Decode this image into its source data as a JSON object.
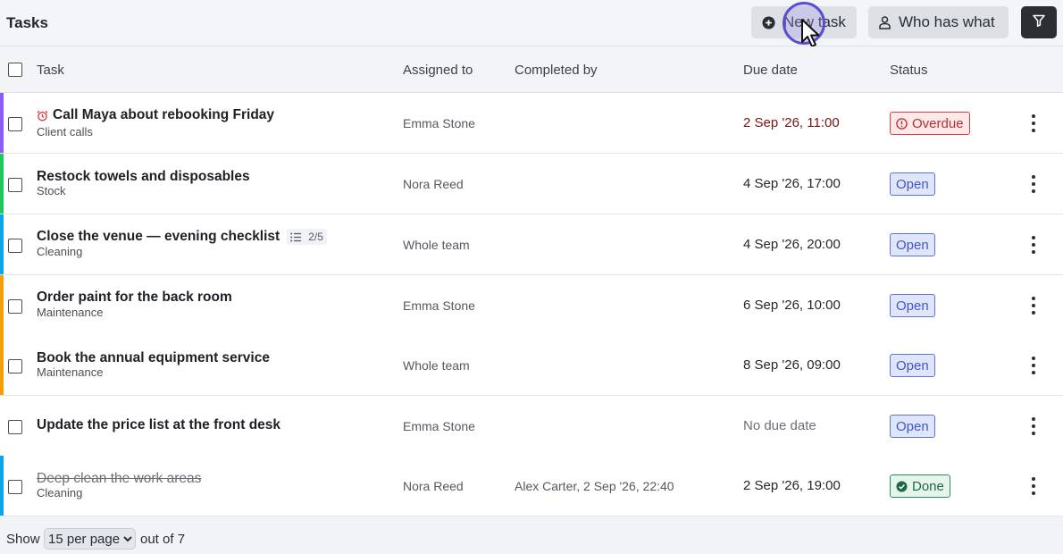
{
  "header": {
    "title": "Tasks",
    "new_task_label": "New task",
    "who_has_what_label": "Who has what",
    "filter_icon": "funnel-icon"
  },
  "columns": {
    "task": "Task",
    "assigned_to": "Assigned to",
    "completed_by": "Completed by",
    "due_date": "Due date",
    "status": "Status"
  },
  "rows": [
    {
      "title": "Call Maya about rebooking Friday",
      "category": "Client calls",
      "assigned": "Emma Stone",
      "completed_by": "",
      "due": "2 Sep '26, 11:00",
      "status": "Overdue",
      "bar_color": "#8b5cf6"
    },
    {
      "title": "Restock towels and disposables",
      "category": "Stock",
      "assigned": "Nora Reed",
      "completed_by": "",
      "due": "4 Sep '26, 17:00",
      "status": "Open",
      "bar_color": "#22c55e"
    },
    {
      "title": "Close the venue — evening checklist",
      "category": "Cleaning",
      "assigned": "Whole team",
      "completed_by": "",
      "due": "4 Sep '26, 20:00",
      "status": "Open",
      "bar_color": "#0ea5e9",
      "subtasks": "2/5"
    },
    {
      "title": "Order paint for the back room",
      "category": "Maintenance",
      "assigned": "Emma Stone",
      "completed_by": "",
      "due": "6 Sep '26, 10:00",
      "status": "Open",
      "bar_color": "#f59e0b"
    },
    {
      "title": "Book the annual equipment service",
      "category": "Maintenance",
      "assigned": "Whole team",
      "completed_by": "",
      "due": "8 Sep '26, 09:00",
      "status": "Open",
      "bar_color": "#f59e0b"
    },
    {
      "title": "Update the price list at the front desk",
      "category": "",
      "assigned": "Emma Stone",
      "completed_by": "",
      "due": "No due date",
      "status": "Open",
      "bar_color": ""
    },
    {
      "title": "Deep clean the work areas",
      "category": "Cleaning",
      "assigned": "Nora Reed",
      "completed_by": "Alex Carter, 2 Sep '26, 22:40",
      "due": "2 Sep '26, 19:00",
      "status": "Done",
      "bar_color": "#0ea5e9"
    }
  ],
  "footer": {
    "show_label": "Show",
    "per_page_selected": "15 per page",
    "out_of_label": "out of 7"
  },
  "colors": {
    "accent_dark": "#2b2e33",
    "status_open": "#4258c6",
    "status_overdue": "#c12a2a",
    "status_done": "#1d6a40",
    "overdue_due_text": "#7a1414"
  }
}
